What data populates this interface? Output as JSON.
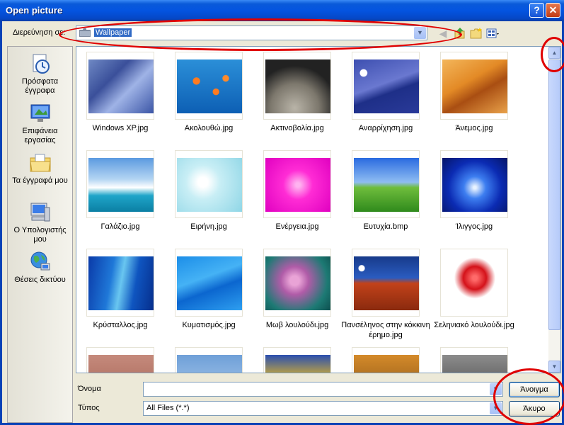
{
  "window": {
    "title": "Open picture",
    "help_glyph": "?",
    "close_glyph": "✕"
  },
  "lookin": {
    "label": "Διερεύνηση σε:",
    "value": "Wallpaper"
  },
  "places": [
    {
      "label": "Πρόσφατα έγγραφα",
      "icon": "recent-documents-icon"
    },
    {
      "label": "Επιφάνεια εργασίας",
      "icon": "desktop-icon"
    },
    {
      "label": "Τα έγγραφά μου",
      "icon": "my-documents-icon"
    },
    {
      "label": "Ο Υπολογιστής μου",
      "icon": "my-computer-icon"
    },
    {
      "label": "Θέσεις δικτύου",
      "icon": "network-places-icon"
    }
  ],
  "files": [
    "Windows XP.jpg",
    "Ακολουθώ.jpg",
    "Ακτινοβολία.jpg",
    "Αναρρίχηση.jpg",
    "Άνεμος.jpg",
    "Γαλάζιο.jpg",
    "Ειρήνη.jpg",
    "Ενέργεια.jpg",
    "Ευτυχία.bmp",
    "Ίλιγγος.jpg",
    "Κρύσταλλος.jpg",
    "Κυματισμός.jpg",
    "Μωβ λουλούδι.jpg",
    "Πανσέληνος στην κόκκινη έρημο.jpg",
    "Σεληνιακό λουλούδι.jpg"
  ],
  "filename": {
    "label": "Όνομα",
    "value": ""
  },
  "filetype": {
    "label": "Τύπος",
    "value": "All Files (*.*)"
  },
  "buttons": {
    "open": "Άνοιγμα",
    "cancel": "Άκυρο"
  },
  "colors": {
    "titlebar": "#0a5ad9",
    "selection": "#316ac5",
    "annotation": "#e00000"
  }
}
